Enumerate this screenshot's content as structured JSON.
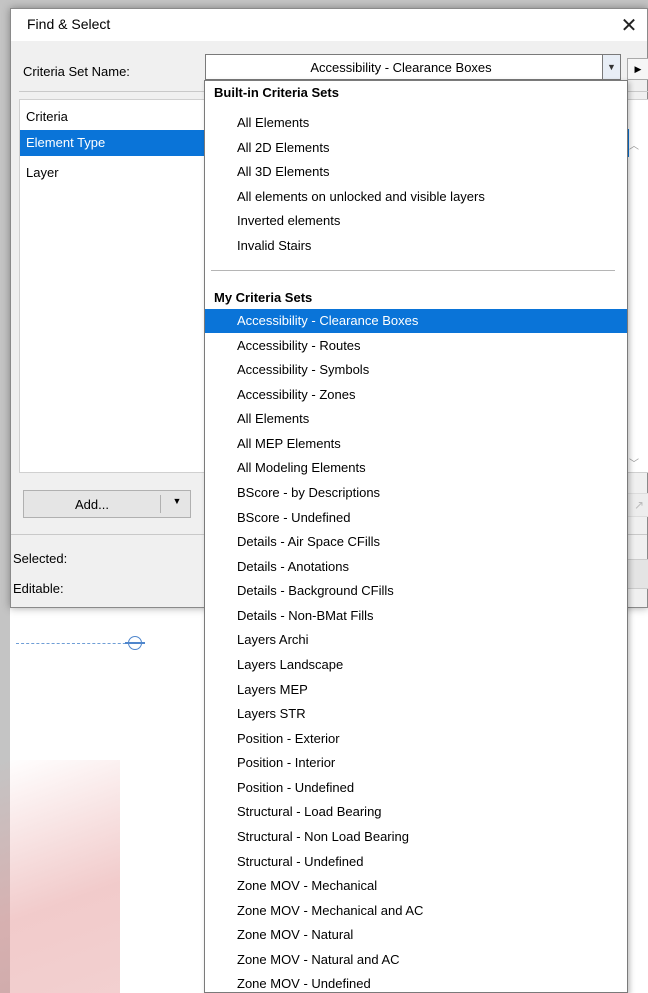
{
  "dialog": {
    "title": "Find & Select",
    "criteria_set_label": "Criteria Set Name:",
    "criteria_set_value": "Accessibility - Clearance Boxes",
    "criteria_items": [
      {
        "label": "Criteria",
        "selected": false
      },
      {
        "label": "Element Type",
        "selected": true
      },
      {
        "label": "Layer",
        "selected": false
      }
    ],
    "add_button_label": "Add...",
    "selected_label": "Selected:",
    "editable_label": "Editable:"
  },
  "dropdown": {
    "builtin_header": "Built-in Criteria Sets",
    "builtin_items": [
      "All Elements",
      "All 2D Elements",
      "All 3D Elements",
      "All elements on unlocked and visible layers",
      "Inverted elements",
      "Invalid Stairs"
    ],
    "my_header": "My Criteria Sets",
    "my_items": [
      "Accessibility - Clearance Boxes",
      "Accessibility - Routes",
      "Accessibility - Symbols",
      "Accessibility - Zones",
      "All Elements",
      "All MEP Elements",
      "All Modeling Elements",
      "BScore - by Descriptions",
      "BScore - Undefined",
      "Details - Air Space CFills",
      "Details - Anotations",
      "Details - Background CFills",
      "Details - Non-BMat Fills",
      "Layers Archi",
      "Layers Landscape",
      "Layers MEP",
      "Layers STR",
      "Position - Exterior",
      "Position - Interior",
      "Position - Undefined",
      "Structural - Load Bearing",
      "Structural - Non Load Bearing",
      "Structural - Undefined",
      "Zone MOV - Mechanical",
      "Zone MOV - Mechanical and AC",
      "Zone MOV - Natural",
      "Zone MOV - Natural and AC",
      "Zone MOV - Undefined"
    ],
    "selected_item": "Accessibility - Clearance Boxes"
  },
  "icons": {
    "close": "close-icon",
    "combo_arrow": "chevron-down-icon",
    "play": "play-icon",
    "add_arrow": "triangle-down-icon"
  },
  "colors": {
    "selection": "#0a74d8",
    "wire": "#4f86cc"
  }
}
